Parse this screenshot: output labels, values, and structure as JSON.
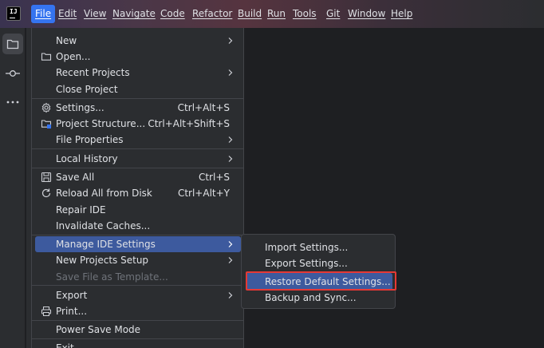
{
  "menubar": {
    "logo_text": "IJ",
    "items": [
      {
        "label": "File",
        "active": true
      },
      {
        "label": "Edit"
      },
      {
        "label": "View"
      },
      {
        "label": "Navigate"
      },
      {
        "label": "Code"
      },
      {
        "label": "Refactor"
      },
      {
        "label": "Build"
      },
      {
        "label": "Run"
      },
      {
        "label": "Tools"
      },
      {
        "label": "Git"
      },
      {
        "label": "Window"
      },
      {
        "label": "Help"
      }
    ]
  },
  "toolstrip": {
    "icons": [
      "folder-icon",
      "commit-icon",
      "more-icon"
    ]
  },
  "file_menu": {
    "items": [
      {
        "label": "New",
        "submenu": true
      },
      {
        "label": "Open...",
        "icon": "folder-icon"
      },
      {
        "label": "Recent Projects",
        "submenu": true
      },
      {
        "label": "Close Project"
      },
      {
        "label": "Settings...",
        "shortcut": "Ctrl+Alt+S",
        "icon": "gear-icon"
      },
      {
        "label": "Project Structure...",
        "shortcut": "Ctrl+Alt+Shift+S",
        "icon": "project-structure-icon"
      },
      {
        "label": "File Properties",
        "submenu": true
      },
      {
        "label": "Local History",
        "submenu": true
      },
      {
        "label": "Save All",
        "shortcut": "Ctrl+S",
        "icon": "save-icon"
      },
      {
        "label": "Reload All from Disk",
        "shortcut": "Ctrl+Alt+Y",
        "icon": "reload-icon"
      },
      {
        "label": "Repair IDE"
      },
      {
        "label": "Invalidate Caches..."
      },
      {
        "label": "Manage IDE Settings",
        "submenu": true,
        "highlighted": true
      },
      {
        "label": "New Projects Setup",
        "submenu": true
      },
      {
        "label": "Save File as Template...",
        "disabled": true
      },
      {
        "label": "Export",
        "submenu": true
      },
      {
        "label": "Print...",
        "icon": "print-icon"
      },
      {
        "label": "Power Save Mode"
      },
      {
        "label": "Exit"
      }
    ]
  },
  "submenu": {
    "items": [
      {
        "label": "Import Settings..."
      },
      {
        "label": "Export Settings..."
      },
      {
        "label": "Restore Default Settings...",
        "highlighted": true
      },
      {
        "label": "Backup and Sync..."
      }
    ]
  },
  "colors": {
    "accent": "#3574f0",
    "highlight": "#3d5a9e",
    "annotation": "#e53935"
  }
}
